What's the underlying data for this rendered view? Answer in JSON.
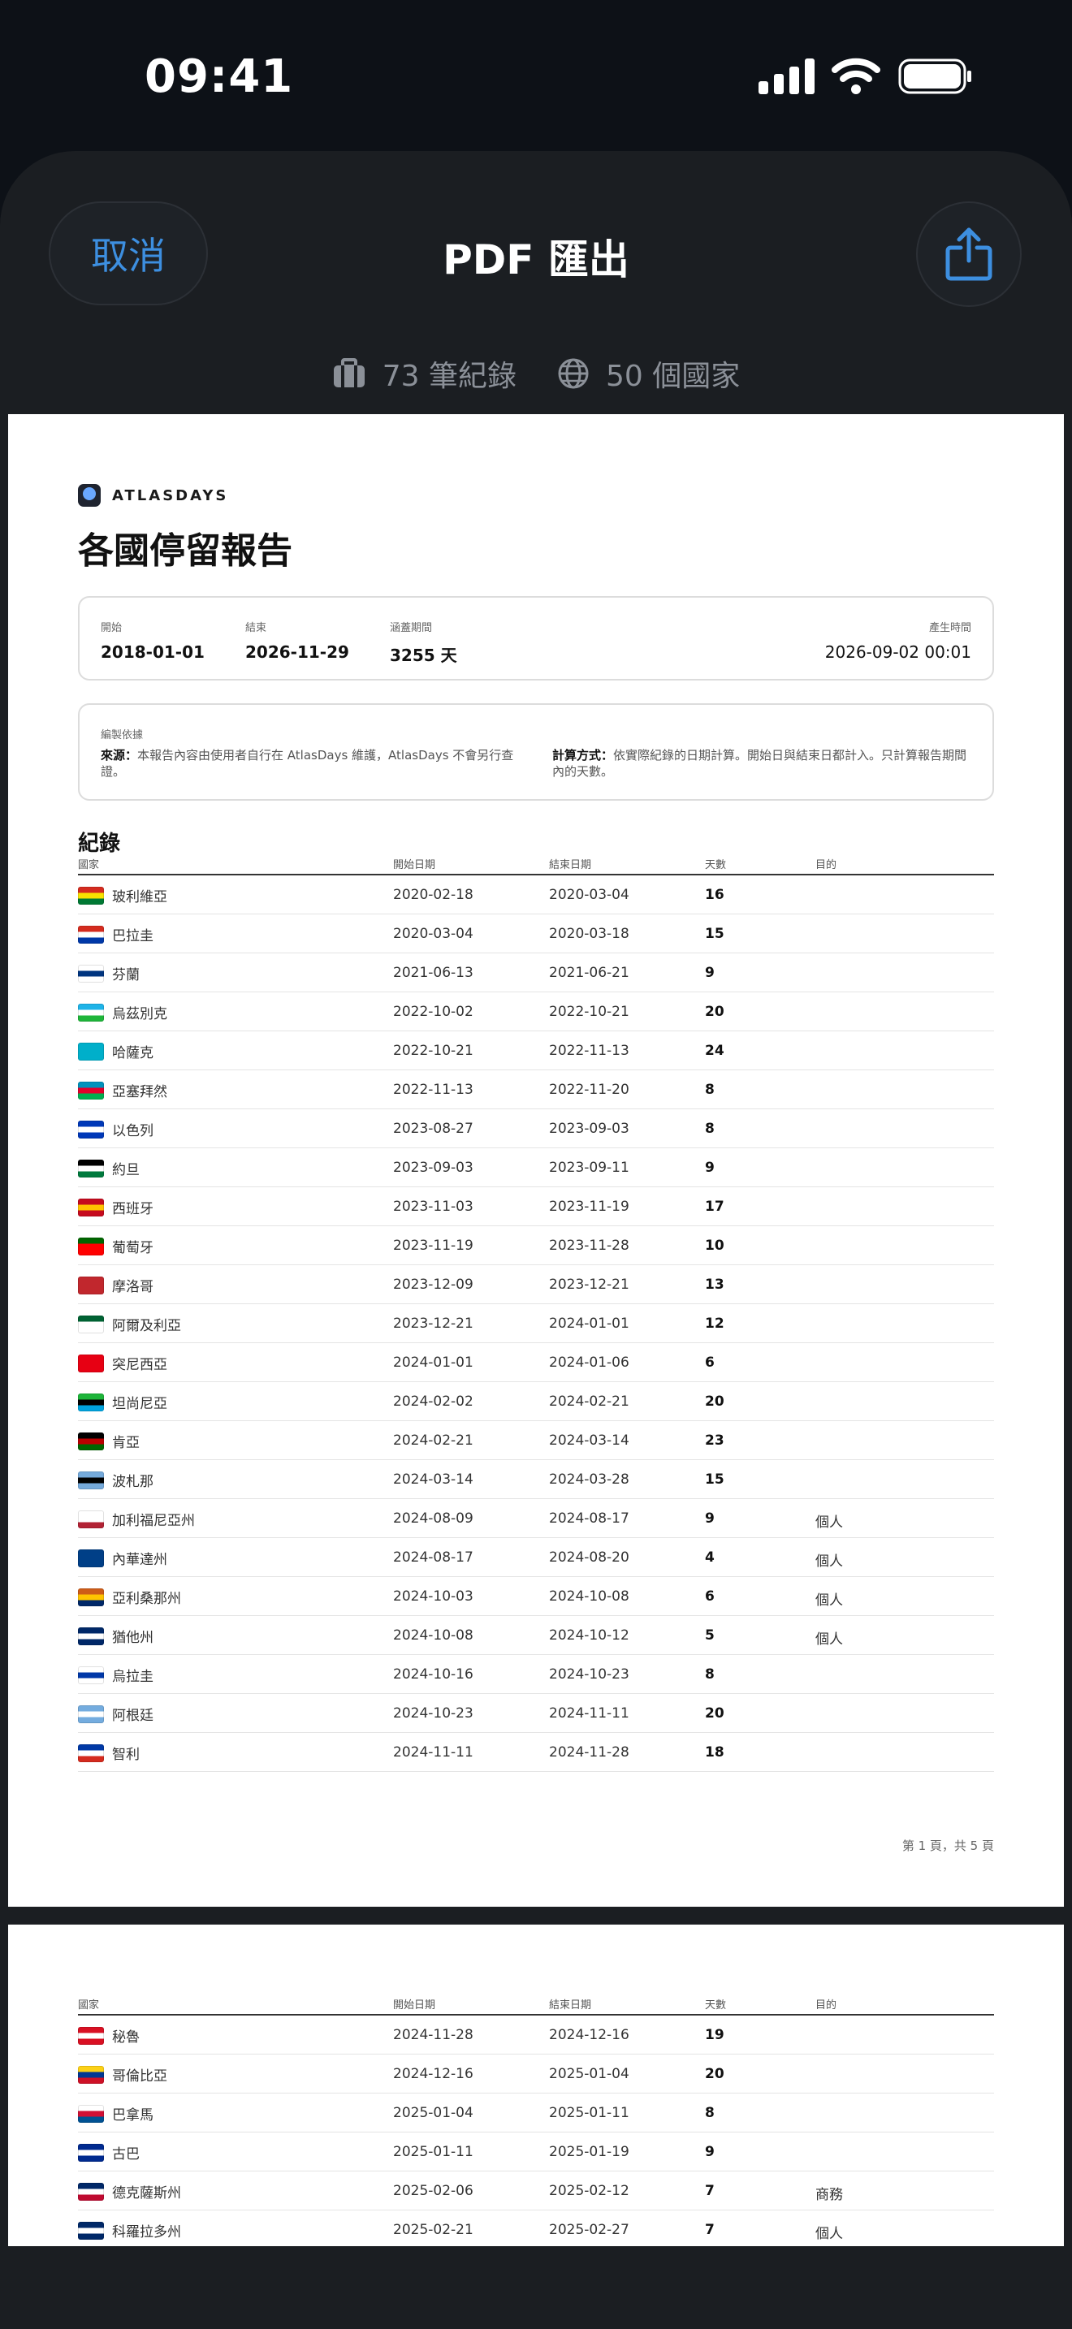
{
  "status": {
    "time": "09:41"
  },
  "nav": {
    "cancel": "取消",
    "title": "PDF 匯出",
    "share_icon": "share-icon"
  },
  "summary": {
    "records": "73 筆紀錄",
    "countries": "50 個國家"
  },
  "report": {
    "brand": "ATLASDAYS",
    "title": "各國停留報告",
    "meta": {
      "start_label": "開始",
      "start": "2018-01-01",
      "end_label": "結束",
      "end": "2026-11-29",
      "period_label": "涵蓋期間",
      "period": "3255 天",
      "generated_label": "產生時間",
      "generated": "2026-09-02 00:01"
    },
    "basis": {
      "title": "編製依據",
      "source_label": "來源：",
      "source": "本報告內容由使用者自行在 AtlasDays 維護，AtlasDays 不會另行查證。",
      "method_label": "計算方式：",
      "method": "依實際紀錄的日期計算。開始日與結束日都計入。只計算報告期間內的天數。"
    },
    "records_title": "紀錄",
    "columns": [
      "國家",
      "開始日期",
      "結束日期",
      "天數",
      "目的"
    ],
    "page1_footer": "第 1 頁，共 5 頁",
    "rows_page1": [
      {
        "country": "玻利維亞",
        "start": "2020-02-18",
        "end": "2020-03-04",
        "days": "16",
        "purpose": "",
        "flag": [
          "#d52b1e",
          "#f9e300",
          "#007934"
        ]
      },
      {
        "country": "巴拉圭",
        "start": "2020-03-04",
        "end": "2020-03-18",
        "days": "15",
        "purpose": "",
        "flag": [
          "#d52b1e",
          "#ffffff",
          "#0038a8"
        ]
      },
      {
        "country": "芬蘭",
        "start": "2021-06-13",
        "end": "2021-06-21",
        "days": "9",
        "purpose": "",
        "flag": [
          "#ffffff",
          "#003580",
          "#ffffff"
        ]
      },
      {
        "country": "烏茲別克",
        "start": "2022-10-02",
        "end": "2022-10-21",
        "days": "20",
        "purpose": "",
        "flag": [
          "#1eb3e8",
          "#ffffff",
          "#1eb53a"
        ]
      },
      {
        "country": "哈薩克",
        "start": "2022-10-21",
        "end": "2022-11-13",
        "days": "24",
        "purpose": "",
        "flag": [
          "#00afca",
          "#00afca",
          "#00afca"
        ]
      },
      {
        "country": "亞塞拜然",
        "start": "2022-11-13",
        "end": "2022-11-20",
        "days": "8",
        "purpose": "",
        "flag": [
          "#0092bc",
          "#e4002b",
          "#00af50"
        ]
      },
      {
        "country": "以色列",
        "start": "2023-08-27",
        "end": "2023-09-03",
        "days": "8",
        "purpose": "",
        "flag": [
          "#0038b8",
          "#ffffff",
          "#0038b8"
        ]
      },
      {
        "country": "約旦",
        "start": "2023-09-03",
        "end": "2023-09-11",
        "days": "9",
        "purpose": "",
        "flag": [
          "#000000",
          "#ffffff",
          "#007a3d"
        ]
      },
      {
        "country": "西班牙",
        "start": "2023-11-03",
        "end": "2023-11-19",
        "days": "17",
        "purpose": "",
        "flag": [
          "#c60b1e",
          "#ffc400",
          "#c60b1e"
        ]
      },
      {
        "country": "葡萄牙",
        "start": "2023-11-19",
        "end": "2023-11-28",
        "days": "10",
        "purpose": "",
        "flag": [
          "#006600",
          "#ff0000",
          "#ff0000"
        ]
      },
      {
        "country": "摩洛哥",
        "start": "2023-12-09",
        "end": "2023-12-21",
        "days": "13",
        "purpose": "",
        "flag": [
          "#c1272d",
          "#c1272d",
          "#c1272d"
        ]
      },
      {
        "country": "阿爾及利亞",
        "start": "2023-12-21",
        "end": "2024-01-01",
        "days": "12",
        "purpose": "",
        "flag": [
          "#006233",
          "#ffffff",
          "#ffffff"
        ]
      },
      {
        "country": "突尼西亞",
        "start": "2024-01-01",
        "end": "2024-01-06",
        "days": "6",
        "purpose": "",
        "flag": [
          "#e70013",
          "#e70013",
          "#e70013"
        ]
      },
      {
        "country": "坦尚尼亞",
        "start": "2024-02-02",
        "end": "2024-02-21",
        "days": "20",
        "purpose": "",
        "flag": [
          "#1eb53a",
          "#000000",
          "#00a3dd"
        ]
      },
      {
        "country": "肯亞",
        "start": "2024-02-21",
        "end": "2024-03-14",
        "days": "23",
        "purpose": "",
        "flag": [
          "#000000",
          "#bb0000",
          "#006600"
        ]
      },
      {
        "country": "波札那",
        "start": "2024-03-14",
        "end": "2024-03-28",
        "days": "15",
        "purpose": "",
        "flag": [
          "#75aadb",
          "#000000",
          "#75aadb"
        ]
      },
      {
        "country": "加利福尼亞州",
        "start": "2024-08-09",
        "end": "2024-08-17",
        "days": "9",
        "purpose": "個人",
        "flag": [
          "#ffffff",
          "#ffffff",
          "#b22234"
        ]
      },
      {
        "country": "內華達州",
        "start": "2024-08-17",
        "end": "2024-08-20",
        "days": "4",
        "purpose": "個人",
        "flag": [
          "#003f87",
          "#003f87",
          "#003f87"
        ]
      },
      {
        "country": "亞利桑那州",
        "start": "2024-10-03",
        "end": "2024-10-08",
        "days": "6",
        "purpose": "個人",
        "flag": [
          "#ce5c17",
          "#ffc400",
          "#002868"
        ]
      },
      {
        "country": "猶他州",
        "start": "2024-10-08",
        "end": "2024-10-12",
        "days": "5",
        "purpose": "個人",
        "flag": [
          "#002868",
          "#ffffff",
          "#002868"
        ]
      },
      {
        "country": "烏拉圭",
        "start": "2024-10-16",
        "end": "2024-10-23",
        "days": "8",
        "purpose": "",
        "flag": [
          "#ffffff",
          "#0038a8",
          "#ffffff"
        ]
      },
      {
        "country": "阿根廷",
        "start": "2024-10-23",
        "end": "2024-11-11",
        "days": "20",
        "purpose": "",
        "flag": [
          "#74acdf",
          "#ffffff",
          "#74acdf"
        ]
      },
      {
        "country": "智利",
        "start": "2024-11-11",
        "end": "2024-11-28",
        "days": "18",
        "purpose": "",
        "flag": [
          "#0039a6",
          "#ffffff",
          "#d52b1e"
        ]
      }
    ],
    "rows_page2": [
      {
        "country": "秘魯",
        "start": "2024-11-28",
        "end": "2024-12-16",
        "days": "19",
        "purpose": "",
        "flag": [
          "#d91023",
          "#ffffff",
          "#d91023"
        ]
      },
      {
        "country": "哥倫比亞",
        "start": "2024-12-16",
        "end": "2025-01-04",
        "days": "20",
        "purpose": "",
        "flag": [
          "#fcd116",
          "#003893",
          "#ce1126"
        ]
      },
      {
        "country": "巴拿馬",
        "start": "2025-01-04",
        "end": "2025-01-11",
        "days": "8",
        "purpose": "",
        "flag": [
          "#ffffff",
          "#d21034",
          "#005293"
        ]
      },
      {
        "country": "古巴",
        "start": "2025-01-11",
        "end": "2025-01-19",
        "days": "9",
        "purpose": "",
        "flag": [
          "#002a8f",
          "#ffffff",
          "#002a8f"
        ]
      },
      {
        "country": "德克薩斯州",
        "start": "2025-02-06",
        "end": "2025-02-12",
        "days": "7",
        "purpose": "商務",
        "flag": [
          "#002868",
          "#ffffff",
          "#bf0a30"
        ]
      },
      {
        "country": "科羅拉多州",
        "start": "2025-02-21",
        "end": "2025-02-27",
        "days": "7",
        "purpose": "個人",
        "flag": [
          "#002868",
          "#ffffff",
          "#002868"
        ]
      }
    ]
  }
}
